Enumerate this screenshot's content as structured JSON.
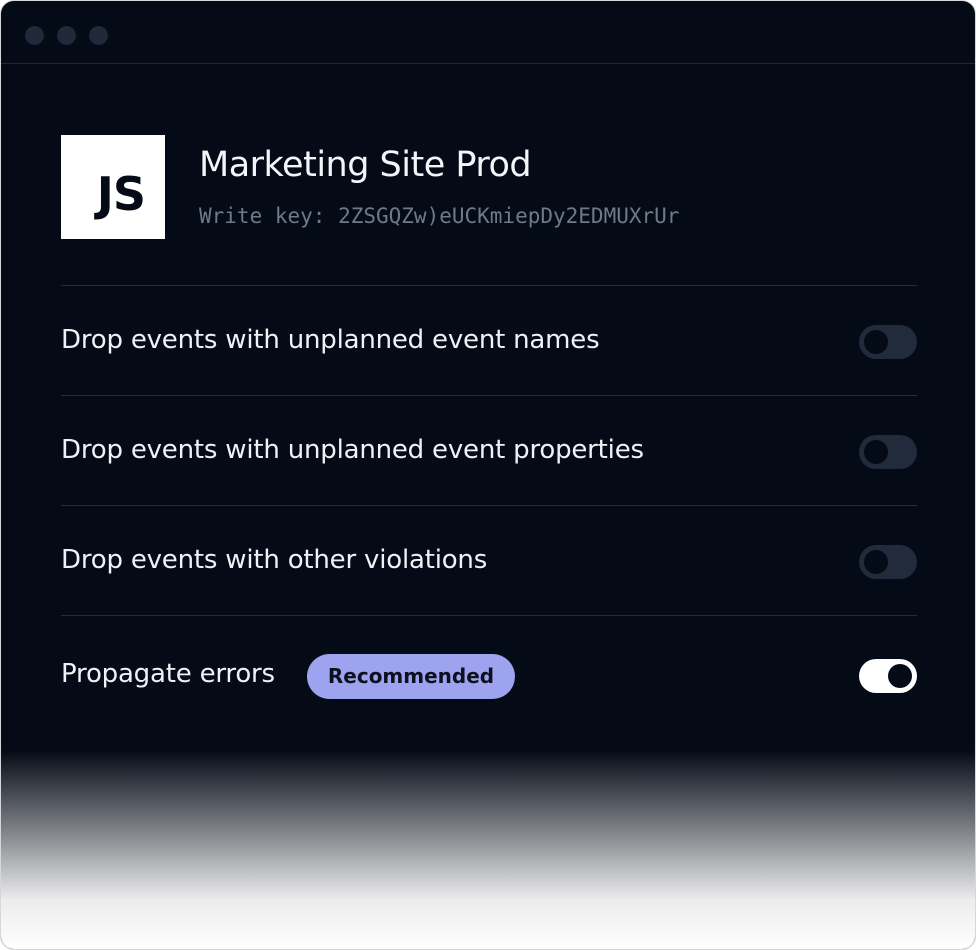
{
  "source": {
    "logo_text": "JS",
    "name": "Marketing Site Prod",
    "write_key": "Write key: 2ZSGQZw)eUCKmiepDy2EDMUXrUr"
  },
  "settings": [
    {
      "label": "Drop events with unplanned event names",
      "enabled": false
    },
    {
      "label": "Drop events with unplanned event properties",
      "enabled": false
    },
    {
      "label": "Drop events with other violations",
      "enabled": false
    },
    {
      "label": "Propagate errors",
      "enabled": true,
      "badge": "Recommended"
    }
  ],
  "colors": {
    "background": "#050b16",
    "badge": "#9ea3ef",
    "toggle_off": "#212b3b",
    "toggle_on": "#ffffff"
  }
}
